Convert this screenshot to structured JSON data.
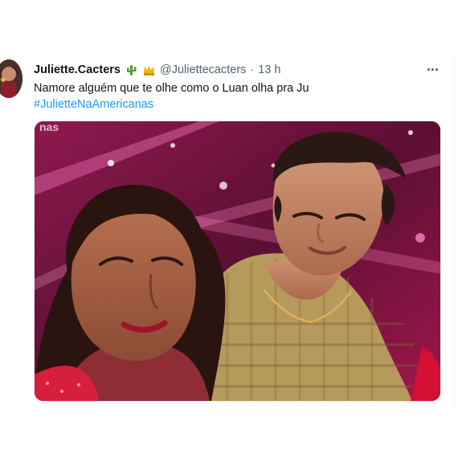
{
  "tweet": {
    "author_name": "Juliette.Cacters",
    "badges": [
      "cactus-emoji",
      "crown-emoji"
    ],
    "handle": "@Juliettecacters",
    "separator": "·",
    "time": "13 h",
    "text": "Namore alguém que te olhe como o Luan olha pra Ju",
    "hashtag": "#JulietteNaAmericanas",
    "more_icon": "more-dots-icon"
  },
  "media": {
    "watermark": "nas"
  },
  "colors": {
    "hashtag": "#1d9bf0",
    "secondary_text": "#536471",
    "primary_text": "#0f1419",
    "media_bg": "#74123e"
  }
}
